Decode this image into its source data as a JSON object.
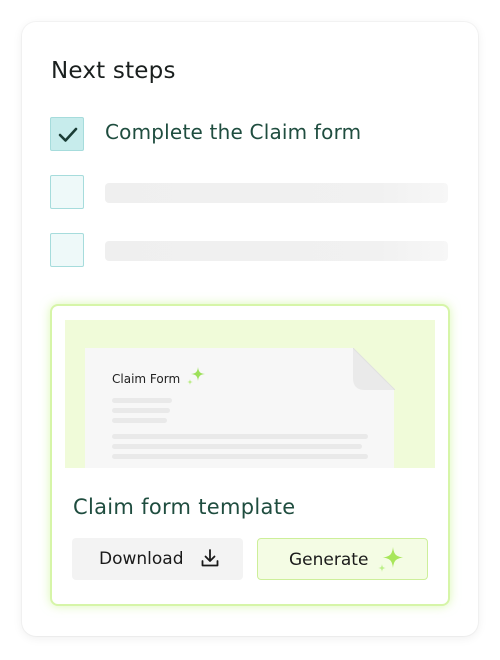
{
  "panel": {
    "title": "Next steps",
    "steps": [
      {
        "label": "Complete the Claim form",
        "checked": true
      },
      {
        "label": "",
        "checked": false
      },
      {
        "label": "",
        "checked": false
      }
    ]
  },
  "template": {
    "preview_doc_title": "Claim Form",
    "title": "Claim form template",
    "download_label": "Download",
    "generate_label": "Generate"
  },
  "icons": {
    "checkmark": "check-icon",
    "download": "download-icon",
    "sparkle": "sparkle-icon"
  },
  "colors": {
    "teal_checkbox": "#c7ecec",
    "accent_green": "#a8e65a",
    "text_dark_green": "#1f4d3f"
  }
}
